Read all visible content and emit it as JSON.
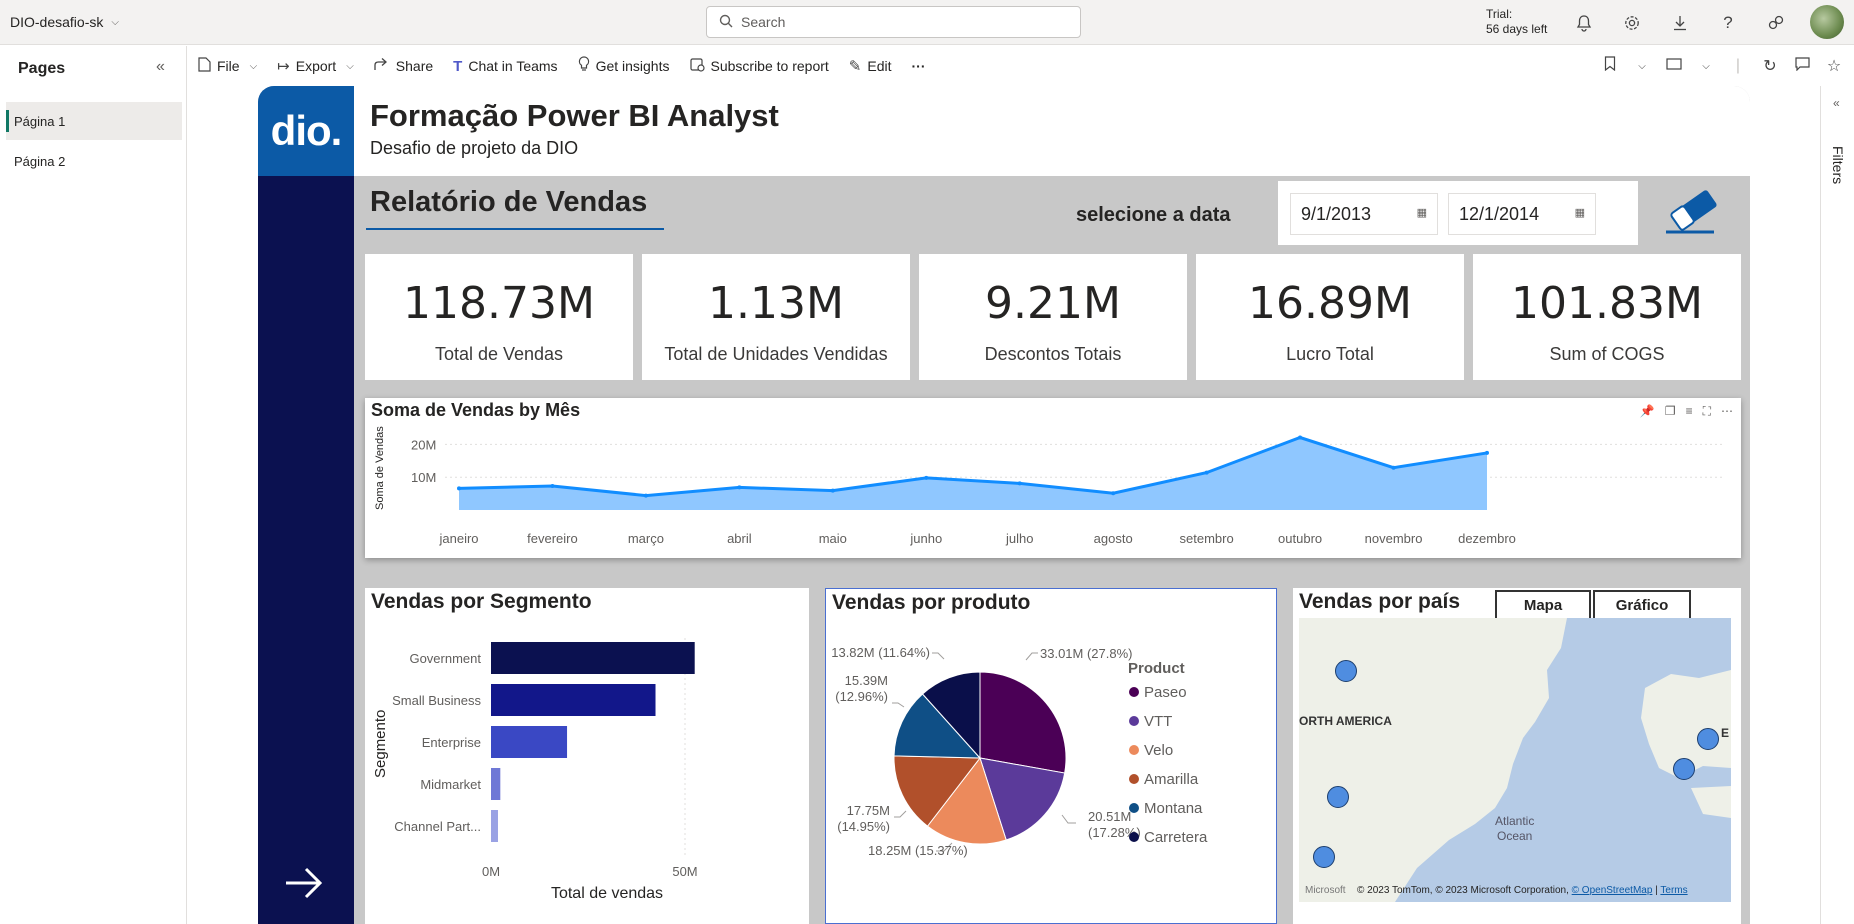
{
  "topbar": {
    "workspace": "DIO-desafio-sk",
    "search_placeholder": "Search",
    "trial_line1": "Trial:",
    "trial_line2": "56 days left"
  },
  "pages": {
    "title": "Pages",
    "items": [
      {
        "label": "Página 1",
        "active": true
      },
      {
        "label": "Página 2",
        "active": false
      }
    ]
  },
  "toolbar": {
    "file": "File",
    "export": "Export",
    "share": "Share",
    "chat": "Chat in Teams",
    "insights": "Get insights",
    "subscribe": "Subscribe to report",
    "edit": "Edit",
    "more": "···"
  },
  "filters_label": "Filters",
  "report": {
    "logo_text": "dio.",
    "title": "Formação Power BI Analyst",
    "subtitle": "Desafio de projeto da DIO",
    "section_title": "Relatório de Vendas",
    "date_label": "selecione a data",
    "date_start": "9/1/2013",
    "date_end": "12/1/2014",
    "kpis": [
      {
        "value": "118.73M",
        "label": "Total de Vendas"
      },
      {
        "value": "1.13M",
        "label": "Total de Unidades Vendidas"
      },
      {
        "value": "9.21M",
        "label": "Descontos Totais"
      },
      {
        "value": "16.89M",
        "label": "Lucro Total"
      },
      {
        "value": "101.83M",
        "label": "Sum of COGS"
      }
    ]
  },
  "chart_data": [
    {
      "type": "area",
      "title": "Soma de Vendas by Mês",
      "xlabel": "",
      "ylabel": "Soma de Vendas",
      "categories": [
        "janeiro",
        "fevereiro",
        "março",
        "abril",
        "maio",
        "junho",
        "julho",
        "agosto",
        "setembro",
        "outubro",
        "novembro",
        "dezembro"
      ],
      "values": [
        6.6,
        7.3,
        4.4,
        6.9,
        5.9,
        9.8,
        8.1,
        5.1,
        11.4,
        22.1,
        12.9,
        17.4
      ],
      "yticks": [
        "10M",
        "20M"
      ],
      "ylim": [
        0,
        25
      ],
      "unit": "M",
      "color": "#118dff",
      "fill": "#8fc7ff"
    },
    {
      "type": "bar",
      "orientation": "horizontal",
      "title": "Vendas por Segmento",
      "xlabel": "Total de vendas",
      "ylabel": "Segmento",
      "categories": [
        "Government",
        "Small Business",
        "Enterprise",
        "Midmarket",
        "Channel Part..."
      ],
      "values": [
        52.5,
        42.4,
        19.6,
        2.4,
        1.8
      ],
      "xticks": [
        "0M",
        "50M"
      ],
      "xlim": [
        0,
        50
      ],
      "colors": [
        "#0b1150",
        "#12178a",
        "#3a48c4",
        "#6f78d6",
        "#9aa2e4"
      ]
    },
    {
      "type": "pie",
      "title": "Vendas por produto",
      "legend_title": "Product",
      "legend_position": "right",
      "slices": [
        {
          "name": "Paseo",
          "value": 33.01,
          "label": "33.01M (27.8%)",
          "color": "#4b0056"
        },
        {
          "name": "VTT",
          "value": 20.51,
          "label_line1": "20.51M",
          "label_line2": "(17.28%)",
          "color": "#5b3a9a"
        },
        {
          "name": "Velo",
          "value": 18.25,
          "label": "18.25M (15.37%)",
          "color": "#ec8a5c"
        },
        {
          "name": "Amarilla",
          "value": 17.75,
          "label_line1": "17.75M",
          "label_line2": "(14.95%)",
          "color": "#b1502b"
        },
        {
          "name": "Montana",
          "value": 15.39,
          "label_line1": "15.39M",
          "label_line2": "(12.96%)",
          "color": "#0f4f86"
        },
        {
          "name": "Carretera",
          "value": 13.82,
          "label": "13.82M (11.64%)",
          "color": "#0a0f4a"
        }
      ]
    }
  ],
  "map": {
    "title": "Vendas por país",
    "btn_map": "Mapa",
    "btn_chart": "Gráfico",
    "label_na": "ORTH AMERICA",
    "label_ocean": "Atlantic\nOcean",
    "label_e": "E",
    "ms_logo": "Microsoft",
    "copyright": "© 2023 TomTom, © 2023 Microsoft Corporation, ",
    "osm": "© OpenStreetMap",
    "terms": "Terms"
  }
}
